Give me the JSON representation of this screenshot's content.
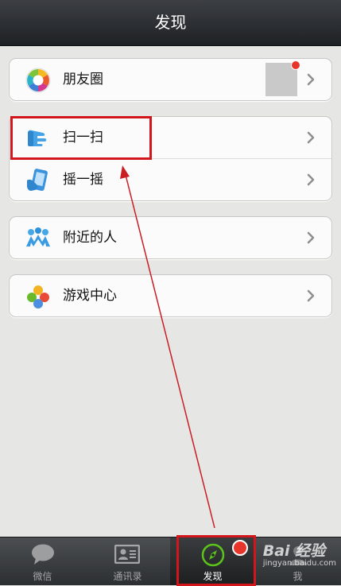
{
  "header": {
    "title": "发现"
  },
  "groups": [
    {
      "items": [
        {
          "label": "朋友圈",
          "icon": "moments-aperture-icon"
        }
      ]
    },
    {
      "items": [
        {
          "label": "扫一扫",
          "icon": "scan-hand-icon"
        },
        {
          "label": "摇一摇",
          "icon": "shake-phone-icon"
        }
      ]
    },
    {
      "items": [
        {
          "label": "附近的人",
          "icon": "people-nearby-icon"
        }
      ]
    },
    {
      "items": [
        {
          "label": "游戏中心",
          "icon": "game-center-icon"
        }
      ]
    }
  ],
  "tabs": [
    {
      "label": "微信",
      "icon": "chat-bubble-icon"
    },
    {
      "label": "通讯录",
      "icon": "contacts-card-icon"
    },
    {
      "label": "发现",
      "icon": "compass-icon",
      "active": true
    },
    {
      "label": "我",
      "icon": "person-icon"
    }
  ],
  "watermark": {
    "brand": "Bai 经验",
    "url": "jingyan.baidu.com"
  },
  "colors": {
    "highlight": "#d2161c",
    "badge": "#e7352b",
    "accent_green": "#5cc31c"
  }
}
